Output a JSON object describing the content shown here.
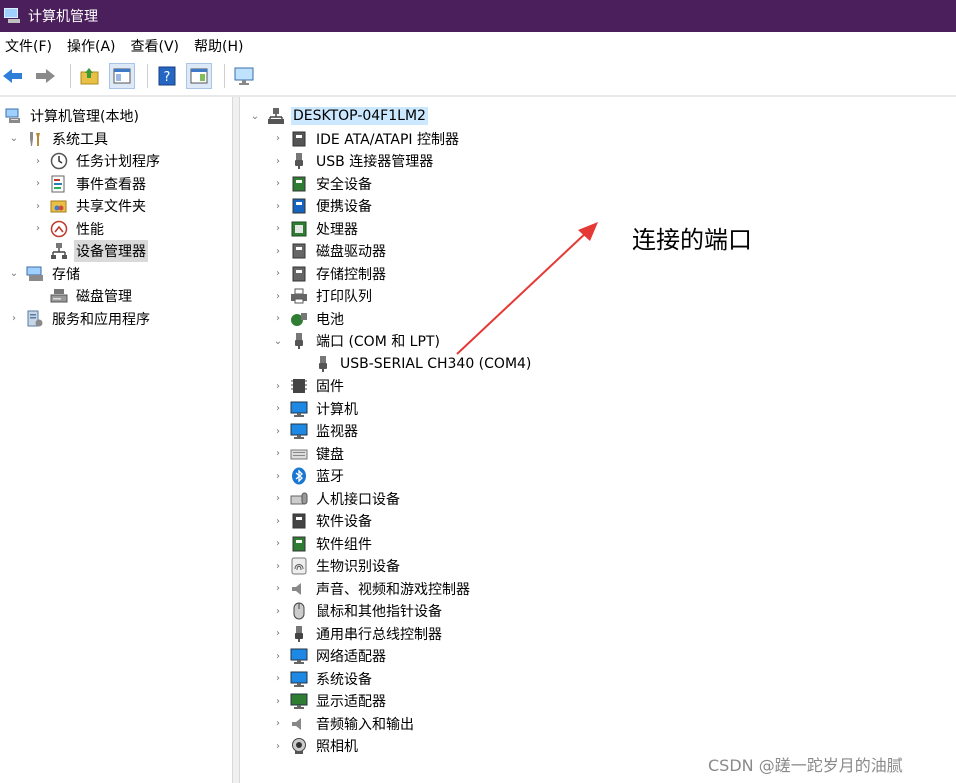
{
  "window": {
    "title": "计算机管理"
  },
  "menu": [
    "文件(F)",
    "操作(A)",
    "查看(V)",
    "帮助(H)"
  ],
  "left_tree": [
    {
      "label": "计算机管理(本地)",
      "depth": 0,
      "expander": "",
      "icon": "computer-management-icon"
    },
    {
      "label": "系统工具",
      "depth": 1,
      "expander": "⌄",
      "icon": "tools-icon"
    },
    {
      "label": "任务计划程序",
      "depth": 2,
      "expander": "›",
      "icon": "clock-icon"
    },
    {
      "label": "事件查看器",
      "depth": 2,
      "expander": "›",
      "icon": "event-viewer-icon"
    },
    {
      "label": "共享文件夹",
      "depth": 2,
      "expander": "›",
      "icon": "shared-folder-icon"
    },
    {
      "label": "性能",
      "depth": 2,
      "expander": "›",
      "icon": "performance-icon"
    },
    {
      "label": "设备管理器",
      "depth": 2,
      "expander": "",
      "icon": "device-manager-icon",
      "selected": true
    },
    {
      "label": "存储",
      "depth": 1,
      "expander": "⌄",
      "icon": "storage-icon"
    },
    {
      "label": "磁盘管理",
      "depth": 2,
      "expander": "",
      "icon": "disk-management-icon"
    },
    {
      "label": "服务和应用程序",
      "depth": 1,
      "expander": "›",
      "icon": "services-icon"
    }
  ],
  "device_tree": {
    "root": "DESKTOP-04F1LM2",
    "categories": [
      {
        "label": "IDE ATA/ATAPI 控制器",
        "icon": "ide-icon",
        "color": "#555555"
      },
      {
        "label": "USB 连接器管理器",
        "icon": "usb-icon",
        "color": "#555555"
      },
      {
        "label": "安全设备",
        "icon": "security-device-icon",
        "color": "#2e7d32"
      },
      {
        "label": "便携设备",
        "icon": "portable-device-icon",
        "color": "#1565c0"
      },
      {
        "label": "处理器",
        "icon": "processor-icon",
        "color": "#2e7d32"
      },
      {
        "label": "磁盘驱动器",
        "icon": "disk-drive-icon",
        "color": "#666666"
      },
      {
        "label": "存储控制器",
        "icon": "storage-controller-icon",
        "color": "#666666"
      },
      {
        "label": "打印队列",
        "icon": "printer-icon",
        "color": "#444444"
      },
      {
        "label": "电池",
        "icon": "battery-icon",
        "color": "#2e7d32"
      },
      {
        "label": "端口 (COM 和 LPT)",
        "icon": "port-icon",
        "color": "#555555",
        "expanded": true,
        "children": [
          "USB-SERIAL CH340 (COM4)"
        ]
      },
      {
        "label": "固件",
        "icon": "firmware-icon",
        "color": "#444444"
      },
      {
        "label": "计算机",
        "icon": "computer-icon",
        "color": "#1e88e5"
      },
      {
        "label": "监视器",
        "icon": "monitor-icon",
        "color": "#1e88e5"
      },
      {
        "label": "键盘",
        "icon": "keyboard-icon",
        "color": "#777777"
      },
      {
        "label": "蓝牙",
        "icon": "bluetooth-icon",
        "color": "#1976d2"
      },
      {
        "label": "人机接口设备",
        "icon": "hid-icon",
        "color": "#666666"
      },
      {
        "label": "软件设备",
        "icon": "software-device-icon",
        "color": "#444444"
      },
      {
        "label": "软件组件",
        "icon": "software-component-icon",
        "color": "#2e7d32"
      },
      {
        "label": "生物识别设备",
        "icon": "fingerprint-icon",
        "color": "#666666"
      },
      {
        "label": "声音、视频和游戏控制器",
        "icon": "sound-icon",
        "color": "#777777"
      },
      {
        "label": "鼠标和其他指针设备",
        "icon": "mouse-icon",
        "color": "#555555"
      },
      {
        "label": "通用串行总线控制器",
        "icon": "usb-controller-icon",
        "color": "#444444"
      },
      {
        "label": "网络适配器",
        "icon": "network-adapter-icon",
        "color": "#1e88e5"
      },
      {
        "label": "系统设备",
        "icon": "system-device-icon",
        "color": "#1e88e5"
      },
      {
        "label": "显示适配器",
        "icon": "display-adapter-icon",
        "color": "#2e7d32"
      },
      {
        "label": "音频输入和输出",
        "icon": "audio-io-icon",
        "color": "#777777"
      },
      {
        "label": "照相机",
        "icon": "camera-icon",
        "color": "#555555"
      }
    ]
  },
  "annotation": {
    "text": "连接的端口",
    "arrow_color": "#e53935"
  },
  "watermark": "CSDN @蹉一跎岁月的油腻"
}
